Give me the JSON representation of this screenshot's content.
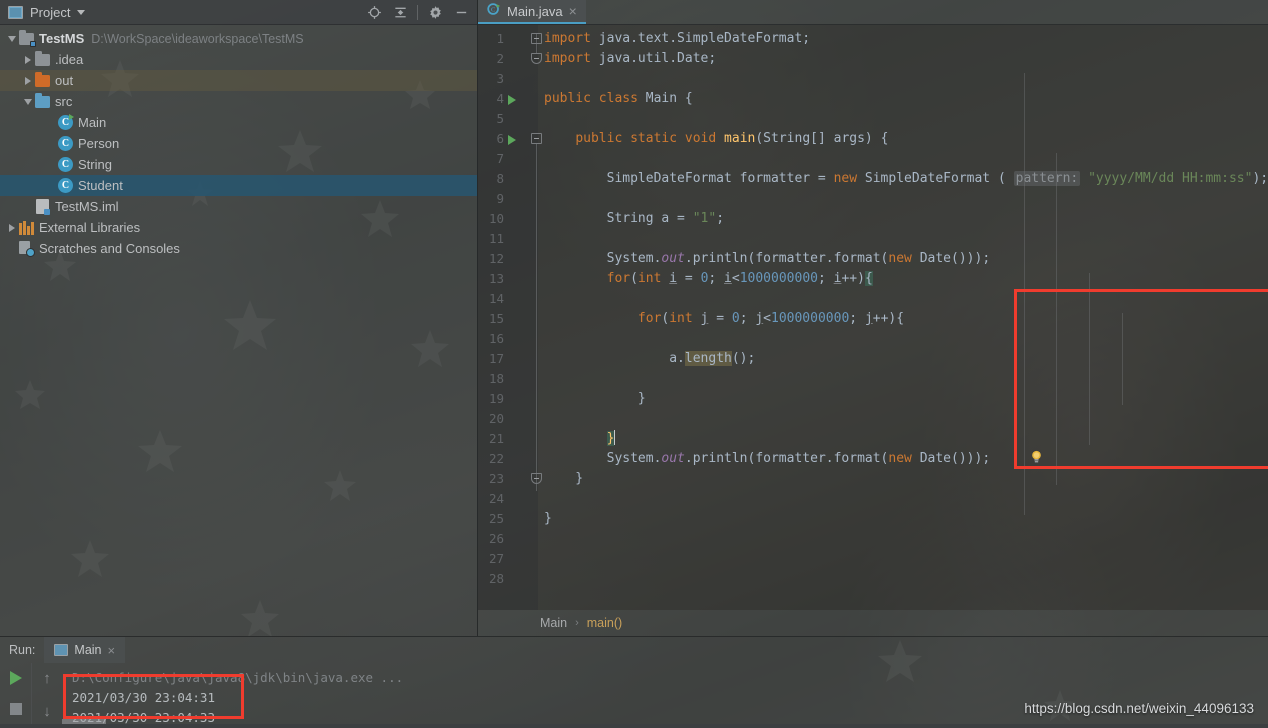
{
  "project_panel": {
    "title": "Project",
    "icons": [
      "project-window-icon",
      "chevron-down-icon",
      "locate-target-icon",
      "collapse-all-icon",
      "settings-gear-icon",
      "minimize-icon"
    ],
    "tree": [
      {
        "label": "TestMS",
        "path_note": "D:\\WorkSpace\\ideaworkspace\\TestMS",
        "icon": "module-folder-icon",
        "twisty": "expanded",
        "indent": 0,
        "state": "normal",
        "bold": true
      },
      {
        "label": ".idea",
        "path_note": "",
        "icon": "folder-icon",
        "twisty": "collapsed",
        "indent": 1,
        "state": "normal",
        "bold": false
      },
      {
        "label": "out",
        "path_note": "",
        "icon": "folder-orange-icon",
        "twisty": "collapsed",
        "indent": 1,
        "state": "tinted",
        "bold": false
      },
      {
        "label": "src",
        "path_note": "",
        "icon": "folder-source-icon",
        "twisty": "expanded",
        "indent": 1,
        "state": "normal",
        "bold": false
      },
      {
        "label": "Main",
        "path_note": "",
        "icon": "java-class-runnable-icon",
        "twisty": "none",
        "indent": 2,
        "state": "normal",
        "bold": false
      },
      {
        "label": "Person",
        "path_note": "",
        "icon": "java-class-icon",
        "twisty": "none",
        "indent": 2,
        "state": "normal",
        "bold": false
      },
      {
        "label": "String",
        "path_note": "",
        "icon": "java-class-icon",
        "twisty": "none",
        "indent": 2,
        "state": "normal",
        "bold": false
      },
      {
        "label": "Student",
        "path_note": "",
        "icon": "java-class-icon",
        "twisty": "none",
        "indent": 2,
        "state": "selected",
        "bold": false
      },
      {
        "label": "TestMS.iml",
        "path_note": "",
        "icon": "iml-file-icon",
        "twisty": "none",
        "indent": 1,
        "state": "normal",
        "bold": false
      },
      {
        "label": "External Libraries",
        "path_note": "",
        "icon": "libraries-icon",
        "twisty": "collapsed",
        "indent": 0,
        "state": "normal",
        "bold": false
      },
      {
        "label": "Scratches and Consoles",
        "path_note": "",
        "icon": "scratches-icon",
        "twisty": "none",
        "indent": 0,
        "state": "normal",
        "bold": false
      }
    ]
  },
  "editor": {
    "tab": {
      "label": "Main.java",
      "icon": "java-class-runnable-icon",
      "close": "×"
    },
    "breadcrumb": {
      "class_name": "Main",
      "separator": "›",
      "method_name": "main()"
    },
    "highlight_box_color": "#f03c2e",
    "lines": [
      {
        "n": "1",
        "marker": "none",
        "fold": "top",
        "text": "import java.text.SimpleDateFormat;"
      },
      {
        "n": "2",
        "marker": "none",
        "fold": "bottom",
        "text": "import java.util.Date;"
      },
      {
        "n": "3",
        "marker": "none",
        "fold": "none",
        "text": ""
      },
      {
        "n": "4",
        "marker": "run",
        "fold": "none",
        "text": "public class Main {"
      },
      {
        "n": "5",
        "marker": "none",
        "fold": "none",
        "text": ""
      },
      {
        "n": "6",
        "marker": "run",
        "fold": "top",
        "text": "    public static void main(String[] args) {"
      },
      {
        "n": "7",
        "marker": "none",
        "fold": "none",
        "text": ""
      },
      {
        "n": "8",
        "marker": "none",
        "fold": "none",
        "text": "        SimpleDateFormat formatter = new SimpleDateFormat ( pattern: \"yyyy/MM/dd HH:mm:ss\");"
      },
      {
        "n": "9",
        "marker": "none",
        "fold": "none",
        "text": ""
      },
      {
        "n": "10",
        "marker": "none",
        "fold": "none",
        "text": "        String a = \"1\";"
      },
      {
        "n": "11",
        "marker": "none",
        "fold": "none",
        "text": ""
      },
      {
        "n": "12",
        "marker": "none",
        "fold": "none",
        "text": "        System.out.println(formatter.format(new Date()));"
      },
      {
        "n": "13",
        "marker": "none",
        "fold": "none",
        "text": "        for(int i = 0; i<1000000000; i++){"
      },
      {
        "n": "14",
        "marker": "none",
        "fold": "none",
        "text": ""
      },
      {
        "n": "15",
        "marker": "none",
        "fold": "none",
        "text": "            for(int j = 0; j<1000000000; j++){"
      },
      {
        "n": "16",
        "marker": "none",
        "fold": "none",
        "text": ""
      },
      {
        "n": "17",
        "marker": "none",
        "fold": "none",
        "text": "                a.length();"
      },
      {
        "n": "18",
        "marker": "none",
        "fold": "none",
        "text": ""
      },
      {
        "n": "19",
        "marker": "none",
        "fold": "none",
        "text": "            }"
      },
      {
        "n": "20",
        "marker": "none",
        "fold": "none",
        "text": ""
      },
      {
        "n": "21",
        "marker": "bulb",
        "fold": "none",
        "text": "        }"
      },
      {
        "n": "22",
        "marker": "none",
        "fold": "none",
        "text": "        System.out.println(formatter.format(new Date()));"
      },
      {
        "n": "23",
        "marker": "none",
        "fold": "bottom",
        "text": "    }"
      },
      {
        "n": "24",
        "marker": "none",
        "fold": "none",
        "text": ""
      },
      {
        "n": "25",
        "marker": "none",
        "fold": "none",
        "text": "}"
      },
      {
        "n": "26",
        "marker": "none",
        "fold": "none",
        "text": ""
      },
      {
        "n": "27",
        "marker": "none",
        "fold": "none",
        "text": ""
      },
      {
        "n": "28",
        "marker": "none",
        "fold": "none",
        "text": ""
      }
    ]
  },
  "run_panel": {
    "label": "Run:",
    "tab": {
      "label": "Main",
      "icon": "run-config-icon",
      "close": "×"
    },
    "buttons": [
      "rerun-icon",
      "stop-icon",
      "prev-occurrence-icon",
      "next-occurrence-icon"
    ],
    "console": [
      {
        "kind": "cmd",
        "text": "D:\\Configure\\java\\java8\\jdk\\bin\\java.exe ..."
      },
      {
        "kind": "out",
        "text": "2021/03/30 23:04:31"
      },
      {
        "kind": "out",
        "text": "2021/03/30 23:04:33"
      }
    ]
  },
  "watermark": {
    "text": "https://blog.csdn.net/weixin_44096133"
  }
}
